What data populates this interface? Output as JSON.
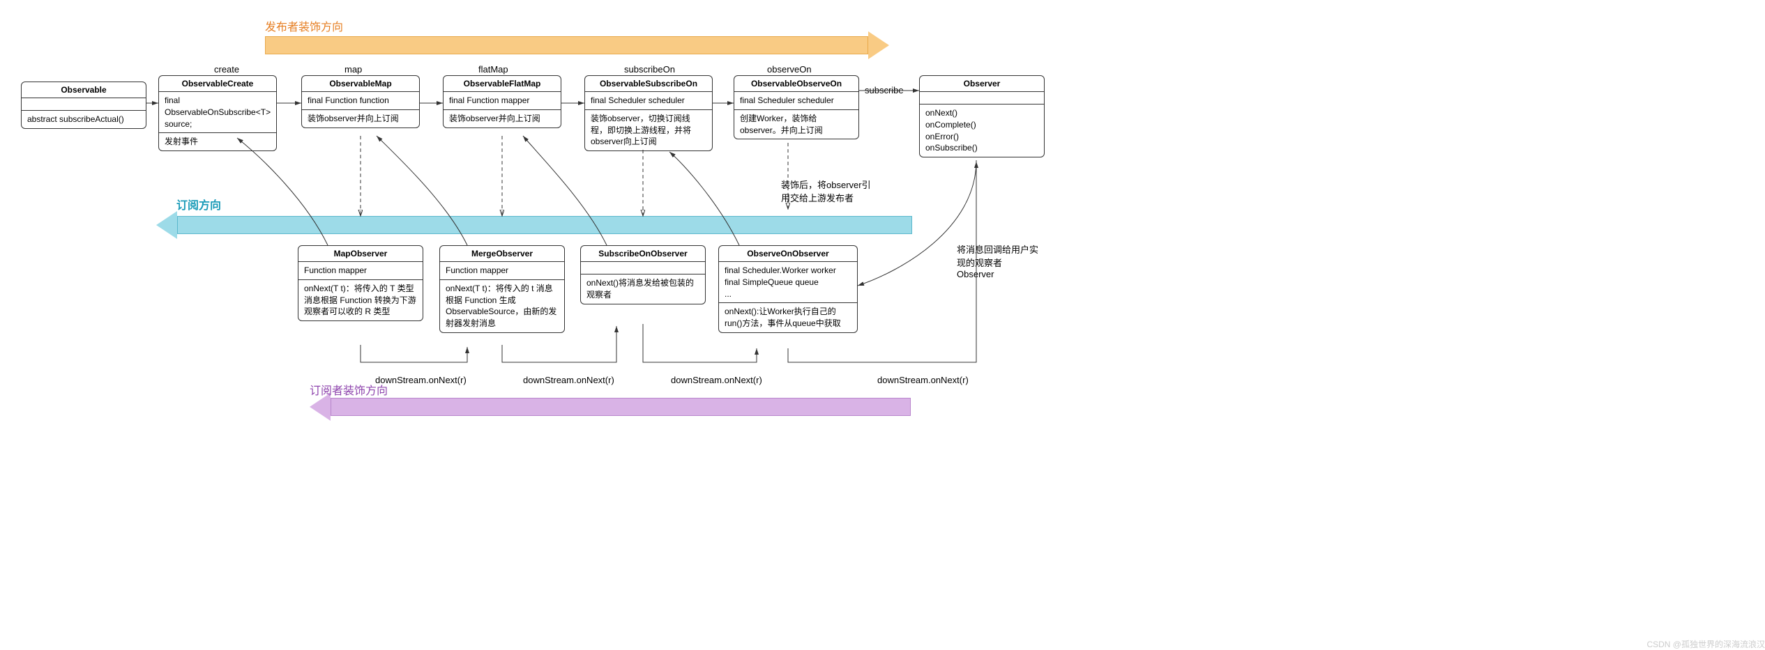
{
  "direction_labels": {
    "publisher_decoration": "发布者装饰方向",
    "subscription": "订阅方向",
    "subscriber_decoration": "订阅者装饰方向"
  },
  "top_labels": {
    "create": "create",
    "map": "map",
    "flatMap": "flatMap",
    "subscribeOn": "subscribeOn",
    "observeOn": "observeOn",
    "subscribe": "subscribe"
  },
  "boxes": {
    "observable": {
      "title": "Observable",
      "row1": "abstract subscribeActual()"
    },
    "observableCreate": {
      "title": "ObservableCreate",
      "row1": "final ObservableOnSubscribe<T> source;",
      "row2": "发射事件"
    },
    "observableMap": {
      "title": "ObservableMap",
      "row1": "final Function function",
      "row2": "装饰observer并向上订阅"
    },
    "observableFlatMap": {
      "title": "ObservableFlatMap",
      "row1": "final Function mapper",
      "row2": "装饰observer并向上订阅"
    },
    "observableSubscribeOn": {
      "title": "ObservableSubscribeOn",
      "row1": "final Scheduler scheduler",
      "row2": "装饰observer，切换订阅线程，即切换上游线程，并将observer向上订阅"
    },
    "observableObserveOn": {
      "title": "ObservableObserveOn",
      "row1": "final Scheduler scheduler",
      "row2": "创建Worker，装饰给observer。并向上订阅"
    },
    "observer": {
      "title": "Observer",
      "row1": "onNext()\nonComplete()\nonError()\nonSubscribe()"
    },
    "mapObserver": {
      "title": "MapObserver",
      "row1": "Function mapper",
      "row2": "onNext(T t)：将传入的 T 类型消息根据 Function 转换为下游观察者可以收的 R 类型"
    },
    "mergeObserver": {
      "title": "MergeObserver",
      "row1": "Function mapper",
      "row2": "onNext(T t)：将传入的 t 消息根据 Function 生成 ObservableSource，由新的发射器发射消息"
    },
    "subscribeOnObserver": {
      "title": "SubscribeOnObserver",
      "row1": "",
      "row2": "onNext()将消息发给被包装的观察者"
    },
    "observeOnObserver": {
      "title": "ObserveOnObserver",
      "row1": "final Scheduler.Worker worker\nfinal SimpleQueue queue\n...",
      "row2": "onNext():让Worker执行自己的run()方法，事件从queue中获取"
    }
  },
  "edge_labels": {
    "decorate_note": "装饰后，将observer引用交给上游发布者",
    "callback_note": "将消息回调给用户实现的观察者 Observer",
    "downstream": "downStream.onNext(r)"
  },
  "watermark": "CSDN @孤独世界的深海流浪汉"
}
